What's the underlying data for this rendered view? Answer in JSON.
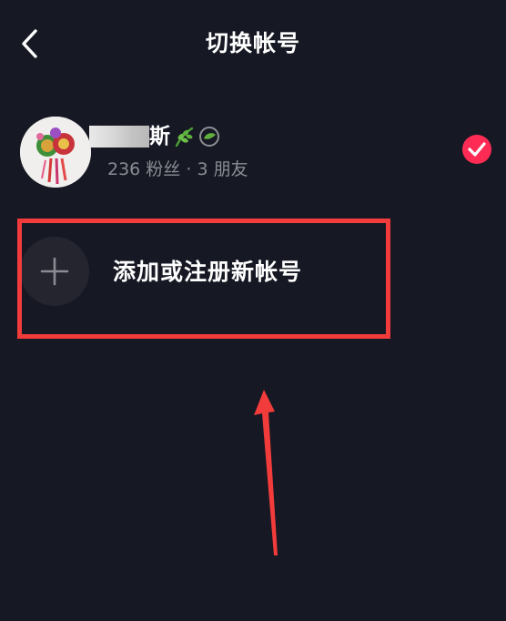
{
  "header": {
    "title": "切换帐号"
  },
  "current_account": {
    "name_suffix": "斯",
    "followers": "236 粉丝",
    "separator": "·",
    "friends": "3 朋友",
    "selected": true,
    "check_color": "#fe2c55"
  },
  "add_account": {
    "label": "添加或注册新帐号"
  },
  "annotation": {
    "color": "#f23b3b"
  },
  "colors": {
    "background": "#161823",
    "secondary_text": "#8b8c93"
  }
}
